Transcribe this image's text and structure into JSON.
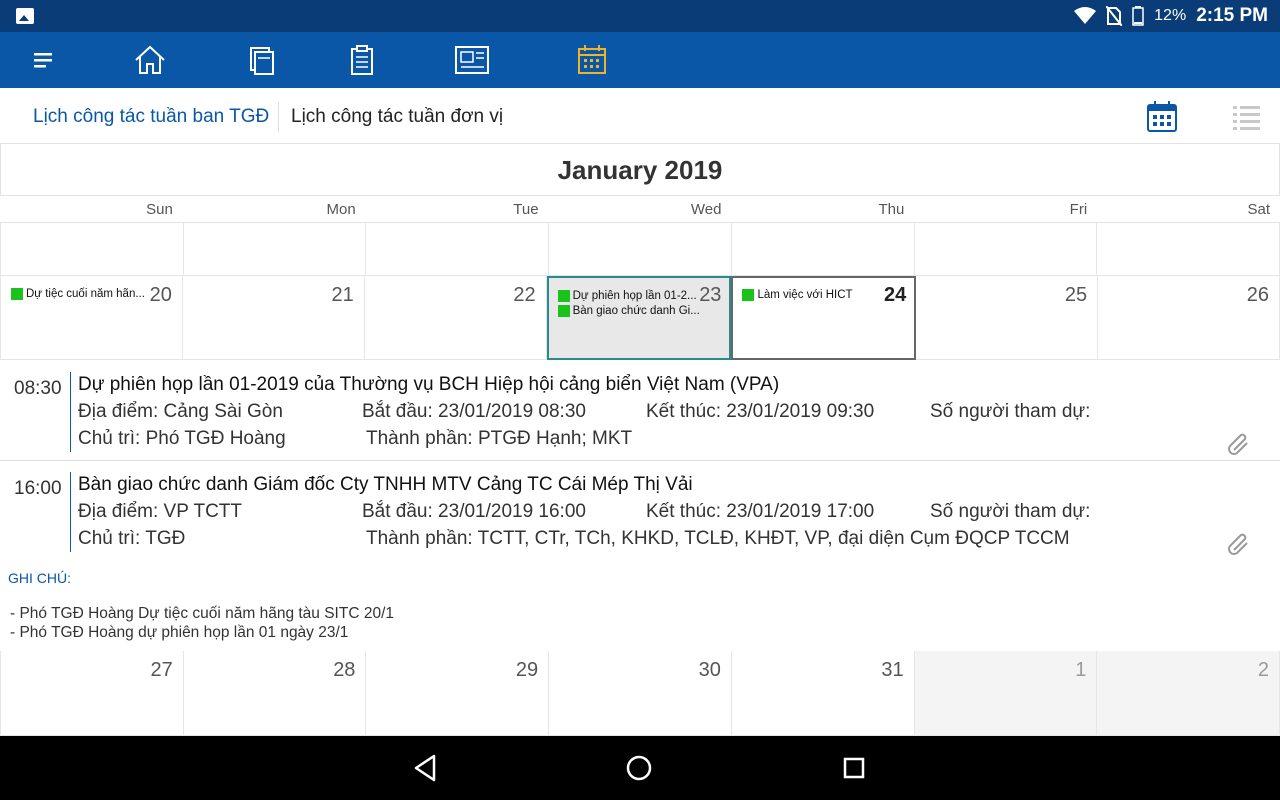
{
  "status_bar": {
    "battery_percent": "12%",
    "time": "2:15 PM",
    "icons": [
      "gallery-icon",
      "wifi-icon",
      "no-sim-icon",
      "battery-icon"
    ]
  },
  "toolbar": {
    "icons": [
      "menu-icon",
      "home-icon",
      "documents-icon",
      "clipboard-icon",
      "news-icon",
      "calendar-icon"
    ],
    "active_color": "#f0b429",
    "background": "#0a57a8"
  },
  "tabs": {
    "items": [
      "Lịch công tác tuần ban TGĐ",
      "Lịch công tác tuần đơn vị"
    ],
    "active_index": 0,
    "view_icons": [
      "calendar-view-icon",
      "list-view-icon"
    ]
  },
  "calendar": {
    "month_title": "January 2019",
    "weekdays": [
      "Sun",
      "Mon",
      "Tue",
      "Wed",
      "Thu",
      "Fri",
      "Sat"
    ],
    "week1": [
      "20",
      "21",
      "22",
      "23",
      "24",
      "25",
      "26"
    ],
    "week2": [
      "27",
      "28",
      "29",
      "30",
      "31",
      "1",
      "2"
    ],
    "events": {
      "sun": "Dự tiệc cuối năm hãn...",
      "wed_1": "Dự phiên họp lần 01-2...",
      "wed_2": "Bàn giao chức danh Gi...",
      "thu": "Làm việc với HICT"
    },
    "event_color": "#1cc21c"
  },
  "details": {
    "events": [
      {
        "time": "08:30",
        "title": "Dự phiên họp lần 01-2019 của Thường vụ BCH Hiệp hội cảng biển Việt Nam (VPA)",
        "location": "Địa điểm: Cảng Sài Gòn",
        "start": "Bắt đầu: 23/01/2019 08:30",
        "end": "Kết thúc: 23/01/2019 09:30",
        "attendees": "Số người tham dự:",
        "chair": "Chủ trì: Phó TGĐ Hoàng",
        "participants": "Thành phần: PTGĐ Hạnh; MKT"
      },
      {
        "time": "16:00",
        "title": "Bàn giao chức danh Giám đốc Cty TNHH MTV Cảng TC Cái Mép Thị Vải",
        "location": "Địa điểm: VP TCTT",
        "start": "Bắt đầu: 23/01/2019 16:00",
        "end": "Kết thúc: 23/01/2019 17:00",
        "attendees": "Số người tham dự:",
        "chair": "Chủ trì: TGĐ",
        "participants": "Thành phần: TCTT, CTr, TCh, KHKD, TCLĐ, KHĐT, VP, đại diện Cụm ĐQCP TCCM"
      }
    ],
    "notes_title": "GHI CHÚ:",
    "notes": [
      "- Phó TGĐ Hoàng Dự tiệc cuối năm hãng tàu SITC 20/1",
      "- Phó TGĐ Hoàng dự phiên họp lần 01 ngày 23/1"
    ]
  },
  "nav_bar": {
    "icons": [
      "back-icon",
      "home-circle-icon",
      "recents-icon"
    ]
  }
}
